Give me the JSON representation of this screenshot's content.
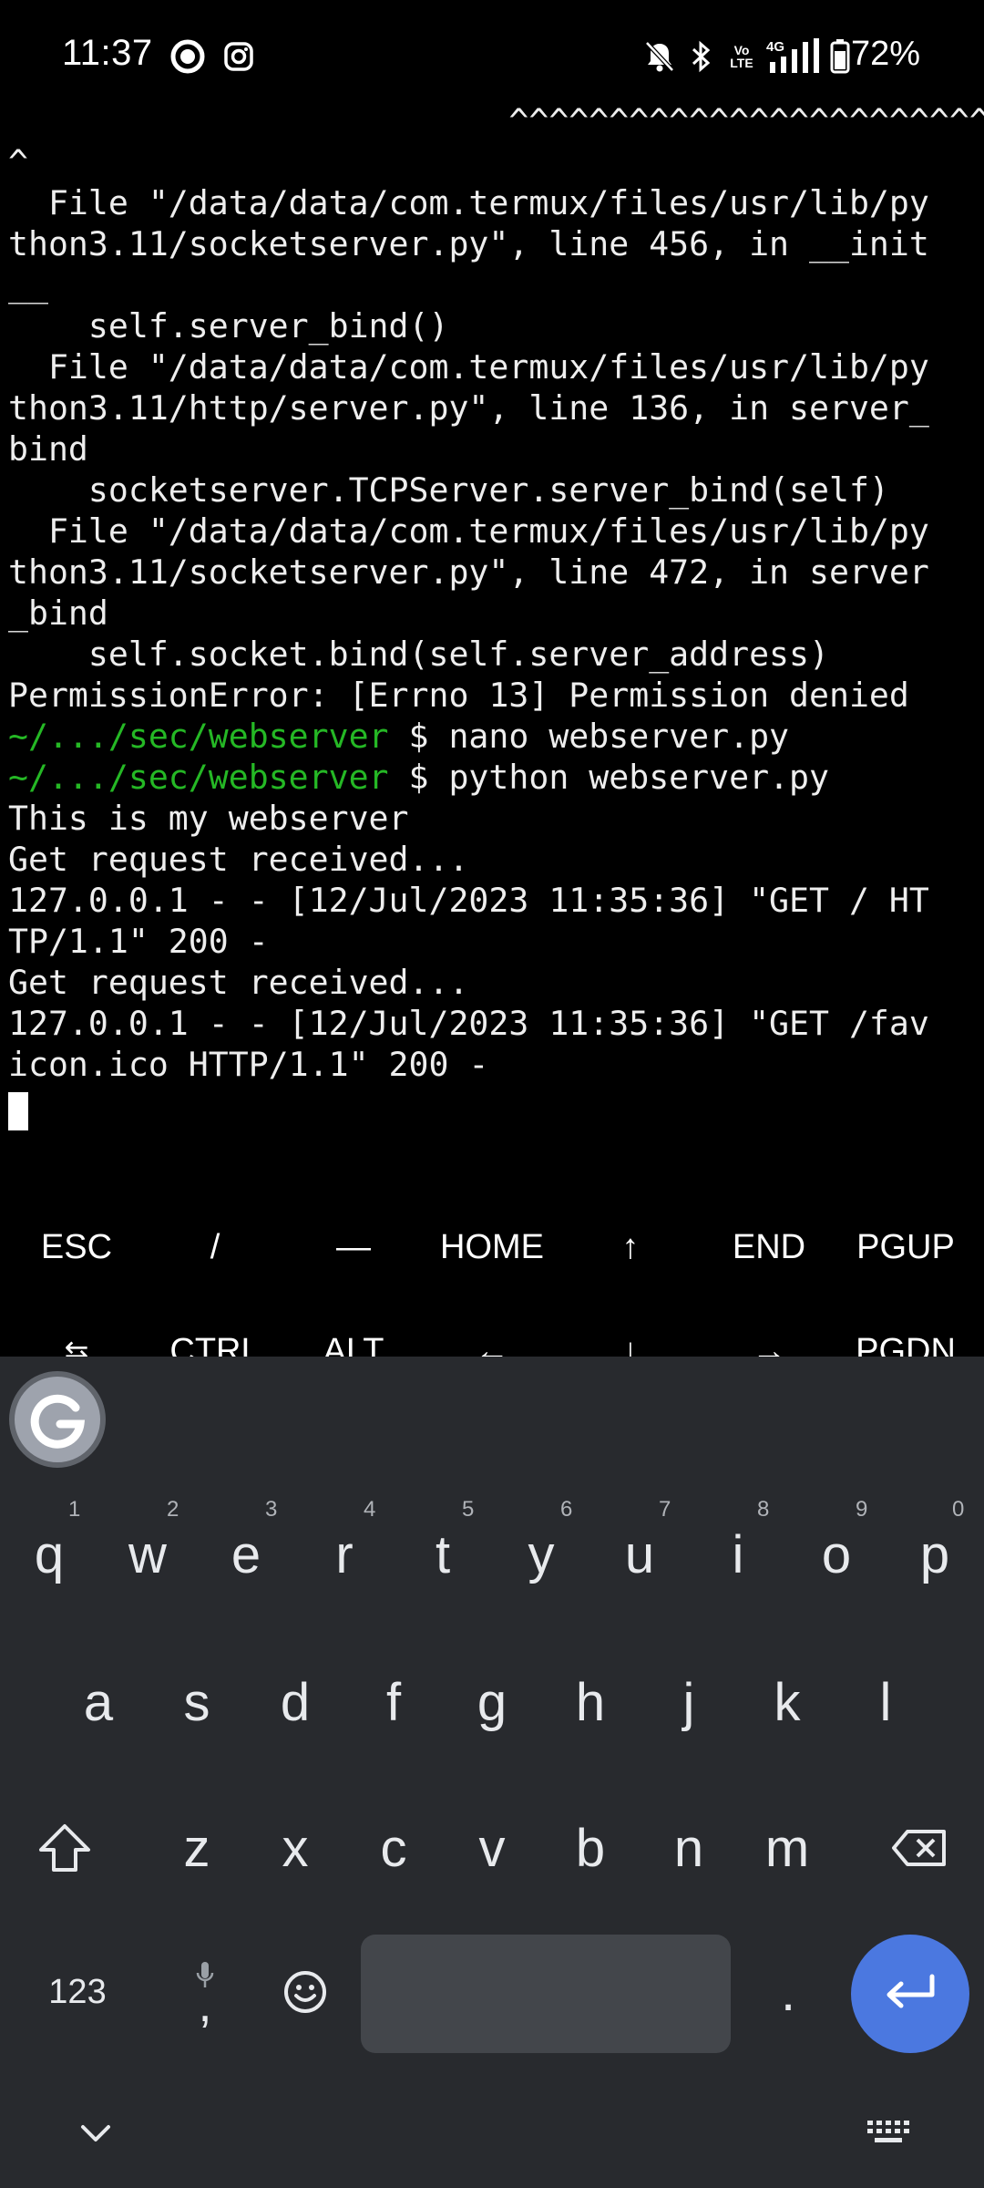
{
  "status_bar": {
    "time": "11:37",
    "battery_percent": "72%",
    "network_label": "4G",
    "icons": [
      "focus-mode-icon",
      "instagram-icon",
      "bell-off-icon",
      "bluetooth-icon",
      "volte-icon",
      "signal-icon",
      "battery-icon"
    ]
  },
  "terminal": {
    "lines": [
      {
        "text": "                         ^^^^^^^^^^^^^^^^^^^^^^^^^^^^^^^^^^^^^^^"
      },
      {
        "text": "^"
      },
      {
        "text": "  File \"/data/data/com.termux/files/usr/lib/py"
      },
      {
        "text": "thon3.11/socketserver.py\", line 456, in __init"
      },
      {
        "text": "__"
      },
      {
        "text": "    self.server_bind()"
      },
      {
        "text": "  File \"/data/data/com.termux/files/usr/lib/py"
      },
      {
        "text": "thon3.11/http/server.py\", line 136, in server_"
      },
      {
        "text": "bind"
      },
      {
        "text": "    socketserver.TCPServer.server_bind(self)"
      },
      {
        "text": "  File \"/data/data/com.termux/files/usr/lib/py"
      },
      {
        "text": "thon3.11/socketserver.py\", line 472, in server"
      },
      {
        "text": "_bind"
      },
      {
        "text": "    self.socket.bind(self.server_address)"
      },
      {
        "text": "PermissionError: [Errno 13] Permission denied"
      },
      {
        "prompt": "~/.../sec/webserver",
        "text": " $ nano webserver.py"
      },
      {
        "prompt": "~/.../sec/webserver",
        "text": " $ python webserver.py"
      },
      {
        "text": "This is my webserver"
      },
      {
        "text": "Get request received..."
      },
      {
        "text": "127.0.0.1 - - [12/Jul/2023 11:35:36] \"GET / HT"
      },
      {
        "text": "TP/1.1\" 200 -"
      },
      {
        "text": "Get request received..."
      },
      {
        "text": "127.0.0.1 - - [12/Jul/2023 11:35:36] \"GET /fav"
      },
      {
        "text": "icon.ico HTTP/1.1\" 200 -"
      }
    ]
  },
  "extra_keys": {
    "row1": [
      "ESC",
      "/",
      "—",
      "HOME",
      "↑",
      "END",
      "PGUP"
    ],
    "row2": [
      "⇆",
      "CTRL",
      "ALT",
      "←",
      "↓",
      "→",
      "PGDN"
    ]
  },
  "keyboard": {
    "row1": [
      "q",
      "w",
      "e",
      "r",
      "t",
      "y",
      "u",
      "i",
      "o",
      "p"
    ],
    "row1_hints": [
      "1",
      "2",
      "3",
      "4",
      "5",
      "6",
      "7",
      "8",
      "9",
      "0"
    ],
    "row2": [
      "a",
      "s",
      "d",
      "f",
      "g",
      "h",
      "j",
      "k",
      "l"
    ],
    "row3": [
      "z",
      "x",
      "c",
      "v",
      "b",
      "n",
      "m"
    ],
    "symbols_label": "123",
    "comma_label": ",",
    "period_label": ".",
    "enter_color": "#4b78e0"
  }
}
